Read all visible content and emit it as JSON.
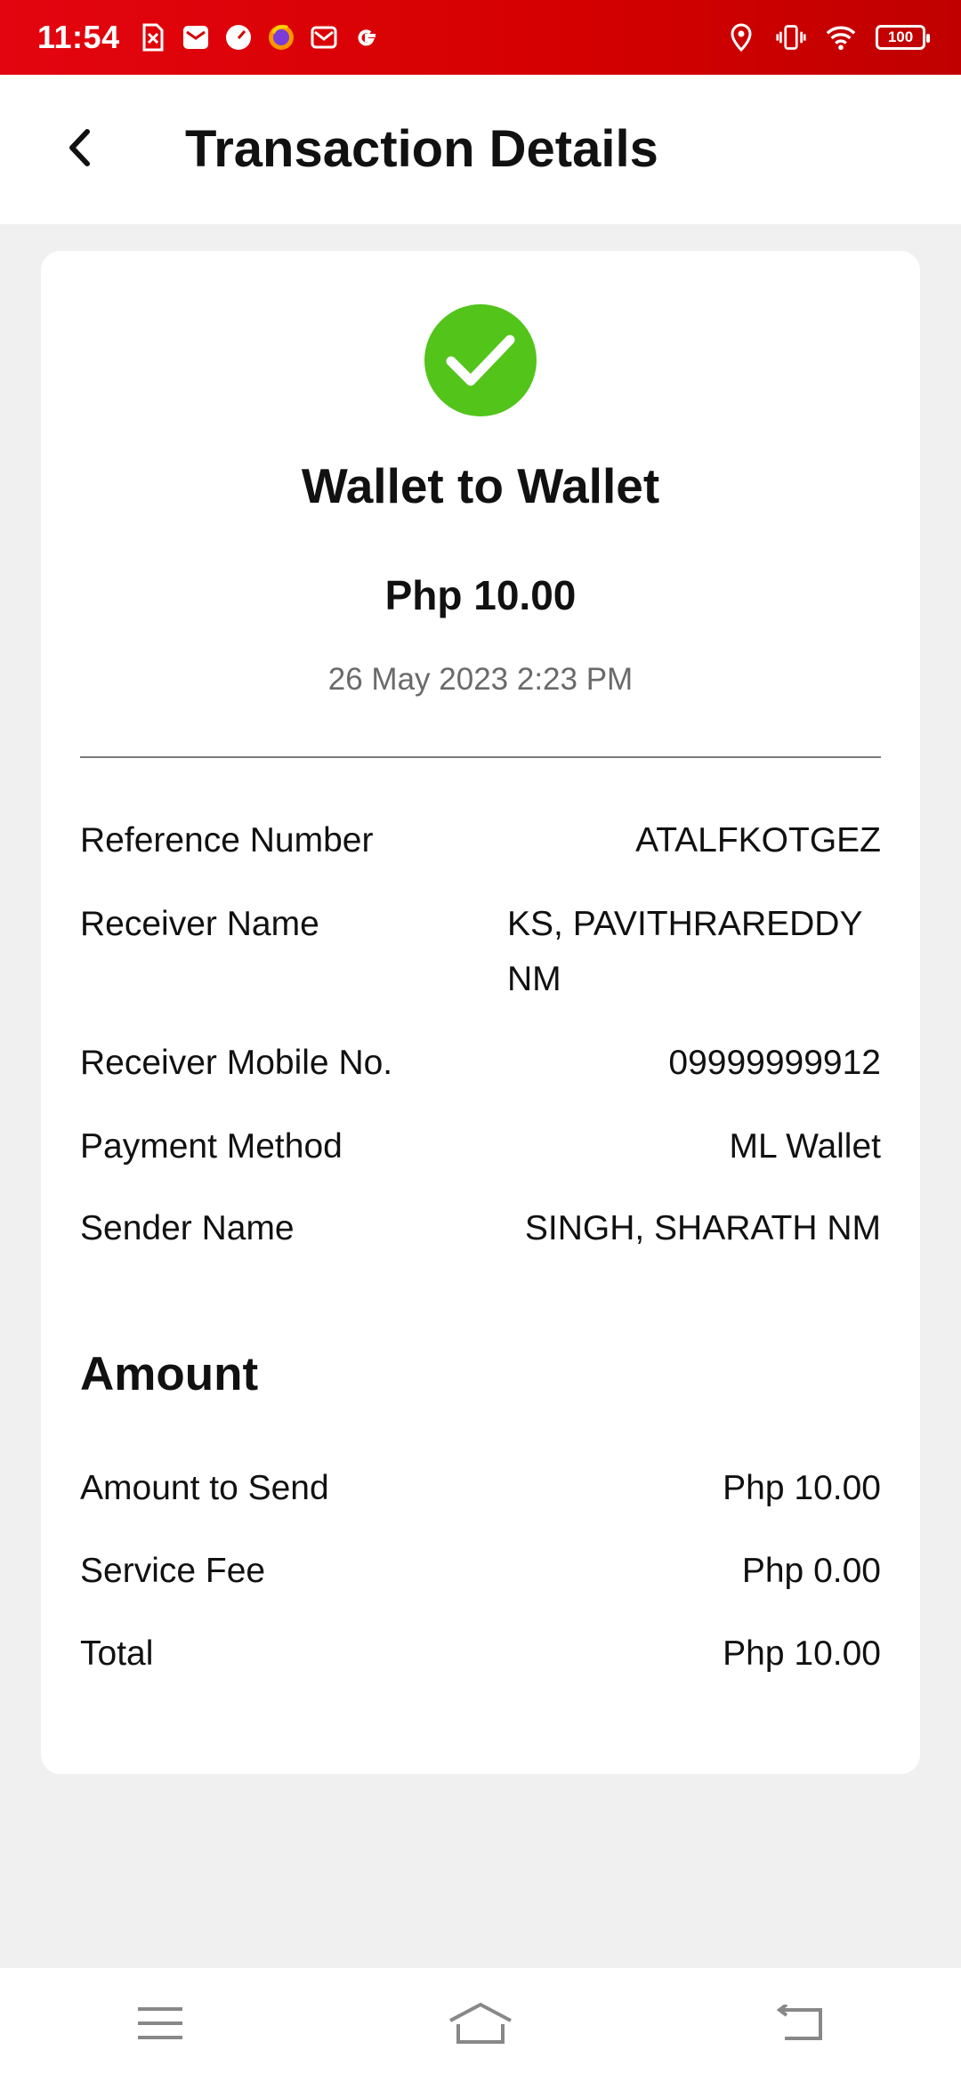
{
  "status_bar": {
    "time": "11:54",
    "battery": "100",
    "left_icons": [
      "sim-error-icon",
      "mail-icon",
      "speedometer-icon",
      "firefox-icon",
      "gmail-icon",
      "google-icon"
    ],
    "right_icons": [
      "location-icon",
      "vibrate-icon",
      "wifi-icon",
      "battery-icon"
    ]
  },
  "header": {
    "title": "Transaction Details",
    "back_icon": "chevron-left-icon"
  },
  "summary": {
    "status_icon": "success-check-icon",
    "status_color": "#52c41a",
    "type": "Wallet to Wallet",
    "amount": "Php 10.00",
    "datetime": "26 May 2023 2:23 PM"
  },
  "details": [
    {
      "label": "Reference Number",
      "value": "ATALFKOTGEZ"
    },
    {
      "label": "Receiver Name",
      "value": "KS, PAVITHRAREDDY NM"
    },
    {
      "label": "Receiver Mobile No.",
      "value": "09999999912"
    },
    {
      "label": "Payment Method",
      "value": "ML Wallet"
    },
    {
      "label": "Sender Name",
      "value": "SINGH, SHARATH NM"
    }
  ],
  "amount_section": {
    "title": "Amount",
    "rows": [
      {
        "label": "Amount to Send",
        "value": "Php 10.00"
      },
      {
        "label": "Service Fee",
        "value": "Php 0.00"
      },
      {
        "label": "Total",
        "value": "Php 10.00"
      }
    ]
  },
  "nav": {
    "items": [
      "menu-icon",
      "home-icon",
      "back-icon"
    ]
  },
  "colors": {
    "status_bar": "#e3050f",
    "background": "#f0f0f0",
    "card": "#ffffff"
  }
}
